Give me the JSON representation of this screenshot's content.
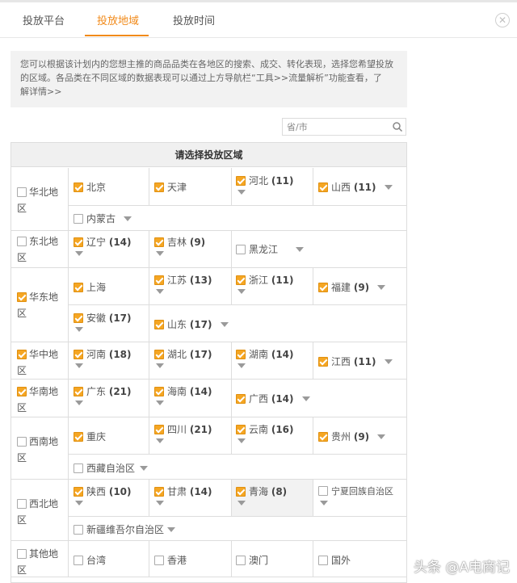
{
  "tabs": [
    {
      "label": "投放平台",
      "active": false
    },
    {
      "label": "投放地域",
      "active": true
    },
    {
      "label": "投放时间",
      "active": false
    }
  ],
  "colors": {
    "accent": "#f18a1a",
    "checkbox_checked": "#f5a623",
    "header_bg": "#f0f0f0"
  },
  "close_icon": "close-icon",
  "info": {
    "line1": "您可以根据该计划内的您想主推的商品品类在各地区的搜索、成交、转化表现，选择您希望投放",
    "line2": "的区域。各品类在不同区域的数据表现可以通过上方导航栏“工具>>流量解析”功能查看，了",
    "line3": "解详情>>"
  },
  "search": {
    "placeholder": "省/市",
    "icon": "search-icon"
  },
  "table": {
    "header": "请选择投放区域",
    "regions": [
      {
        "name": "华北地区",
        "checked": false,
        "provinces": [
          {
            "name": "北京",
            "count": "",
            "checked": true,
            "has_dropdown": false
          },
          {
            "name": "天津",
            "count": "",
            "checked": true,
            "has_dropdown": false
          },
          {
            "name": "河北",
            "count": "(11)",
            "checked": true,
            "has_dropdown": true
          },
          {
            "name": "山西",
            "count": "(11)",
            "checked": true,
            "has_dropdown": true
          },
          {
            "name": "内蒙古",
            "count": "",
            "checked": false,
            "has_dropdown": true
          }
        ]
      },
      {
        "name": "东北地区",
        "checked": false,
        "provinces": [
          {
            "name": "辽宁",
            "count": "(14)",
            "checked": true,
            "has_dropdown": true
          },
          {
            "name": "吉林",
            "count": "(9)",
            "checked": true,
            "has_dropdown": true
          },
          {
            "name": "黑龙江",
            "count": "",
            "checked": false,
            "has_dropdown": true
          }
        ]
      },
      {
        "name": "华东地区",
        "checked": true,
        "provinces": [
          {
            "name": "上海",
            "count": "",
            "checked": true,
            "has_dropdown": false
          },
          {
            "name": "江苏",
            "count": "(13)",
            "checked": true,
            "has_dropdown": true
          },
          {
            "name": "浙江",
            "count": "(11)",
            "checked": true,
            "has_dropdown": true
          },
          {
            "name": "福建",
            "count": "(9)",
            "checked": true,
            "has_dropdown": true
          },
          {
            "name": "安徽",
            "count": "(17)",
            "checked": true,
            "has_dropdown": true
          },
          {
            "name": "山东",
            "count": "(17)",
            "checked": true,
            "has_dropdown": true
          }
        ]
      },
      {
        "name": "华中地区",
        "checked": true,
        "provinces": [
          {
            "name": "河南",
            "count": "(18)",
            "checked": true,
            "has_dropdown": true
          },
          {
            "name": "湖北",
            "count": "(17)",
            "checked": true,
            "has_dropdown": true
          },
          {
            "name": "湖南",
            "count": "(14)",
            "checked": true,
            "has_dropdown": true
          },
          {
            "name": "江西",
            "count": "(11)",
            "checked": true,
            "has_dropdown": true
          }
        ]
      },
      {
        "name": "华南地区",
        "checked": true,
        "provinces": [
          {
            "name": "广东",
            "count": "(21)",
            "checked": true,
            "has_dropdown": true
          },
          {
            "name": "海南",
            "count": "(14)",
            "checked": true,
            "has_dropdown": true
          },
          {
            "name": "广西",
            "count": "(14)",
            "checked": true,
            "has_dropdown": true
          }
        ]
      },
      {
        "name": "西南地区",
        "checked": false,
        "provinces": [
          {
            "name": "重庆",
            "count": "",
            "checked": true,
            "has_dropdown": false
          },
          {
            "name": "四川",
            "count": "(21)",
            "checked": true,
            "has_dropdown": true
          },
          {
            "name": "云南",
            "count": "(16)",
            "checked": true,
            "has_dropdown": true
          },
          {
            "name": "贵州",
            "count": "(9)",
            "checked": true,
            "has_dropdown": true
          },
          {
            "name": "西藏自治区",
            "count": "",
            "checked": false,
            "has_dropdown": true
          }
        ]
      },
      {
        "name": "西北地区",
        "checked": false,
        "provinces": [
          {
            "name": "陕西",
            "count": "(10)",
            "checked": true,
            "has_dropdown": true
          },
          {
            "name": "甘肃",
            "count": "(14)",
            "checked": true,
            "has_dropdown": true
          },
          {
            "name": "青海",
            "count": "(8)",
            "checked": true,
            "has_dropdown": true
          },
          {
            "name": "宁夏回族自治区",
            "count": "",
            "checked": false,
            "has_dropdown": true
          },
          {
            "name": "新疆维吾尔自治区",
            "count": "",
            "checked": false,
            "has_dropdown": true
          }
        ]
      },
      {
        "name": "其他地区",
        "checked": false,
        "provinces": [
          {
            "name": "台湾",
            "count": "",
            "checked": false,
            "has_dropdown": false
          },
          {
            "name": "香港",
            "count": "",
            "checked": false,
            "has_dropdown": false
          },
          {
            "name": "澳门",
            "count": "",
            "checked": false,
            "has_dropdown": false
          },
          {
            "name": "国外",
            "count": "",
            "checked": false,
            "has_dropdown": false
          }
        ]
      }
    ]
  },
  "watermark": "头条 @A电商记"
}
